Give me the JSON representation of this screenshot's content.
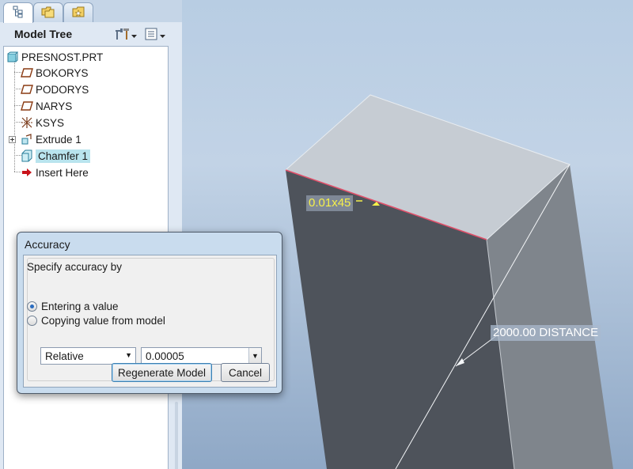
{
  "panel": {
    "tabs": [
      {
        "name": "model-tree-tab-icon"
      },
      {
        "name": "folder-browser-tab-icon"
      },
      {
        "name": "favorites-tab-icon"
      }
    ],
    "title": "Model Tree"
  },
  "tree": {
    "root": "PRESNOST.PRT",
    "items": [
      {
        "label": "BOKORYS",
        "icon": "datum-plane-icon"
      },
      {
        "label": "PODORYS",
        "icon": "datum-plane-icon"
      },
      {
        "label": "NARYS",
        "icon": "datum-plane-icon"
      },
      {
        "label": "KSYS",
        "icon": "coordinate-system-icon"
      },
      {
        "label": "Extrude 1",
        "icon": "extrude-icon"
      },
      {
        "label": "Chamfer 1",
        "icon": "chamfer-icon"
      },
      {
        "label": "Insert Here",
        "icon": "insert-arrow-icon"
      }
    ],
    "selected": "Chamfer 1"
  },
  "viewport": {
    "chamfer_annotation": "0.01x45",
    "distance_annotation": "2000.00  DISTANCE",
    "colors": {
      "annotation_yellow": "#f5f04a",
      "edge_highlight": "#e0506a"
    }
  },
  "dialog": {
    "title": "Accuracy",
    "group_label": "Specify accuracy by",
    "radio_entering": "Entering a value",
    "radio_copying": "Copying value from model",
    "mode_value": "Relative",
    "accuracy_value": "0.00005",
    "regenerate_label": "Regenerate Model",
    "cancel_label": "Cancel"
  }
}
